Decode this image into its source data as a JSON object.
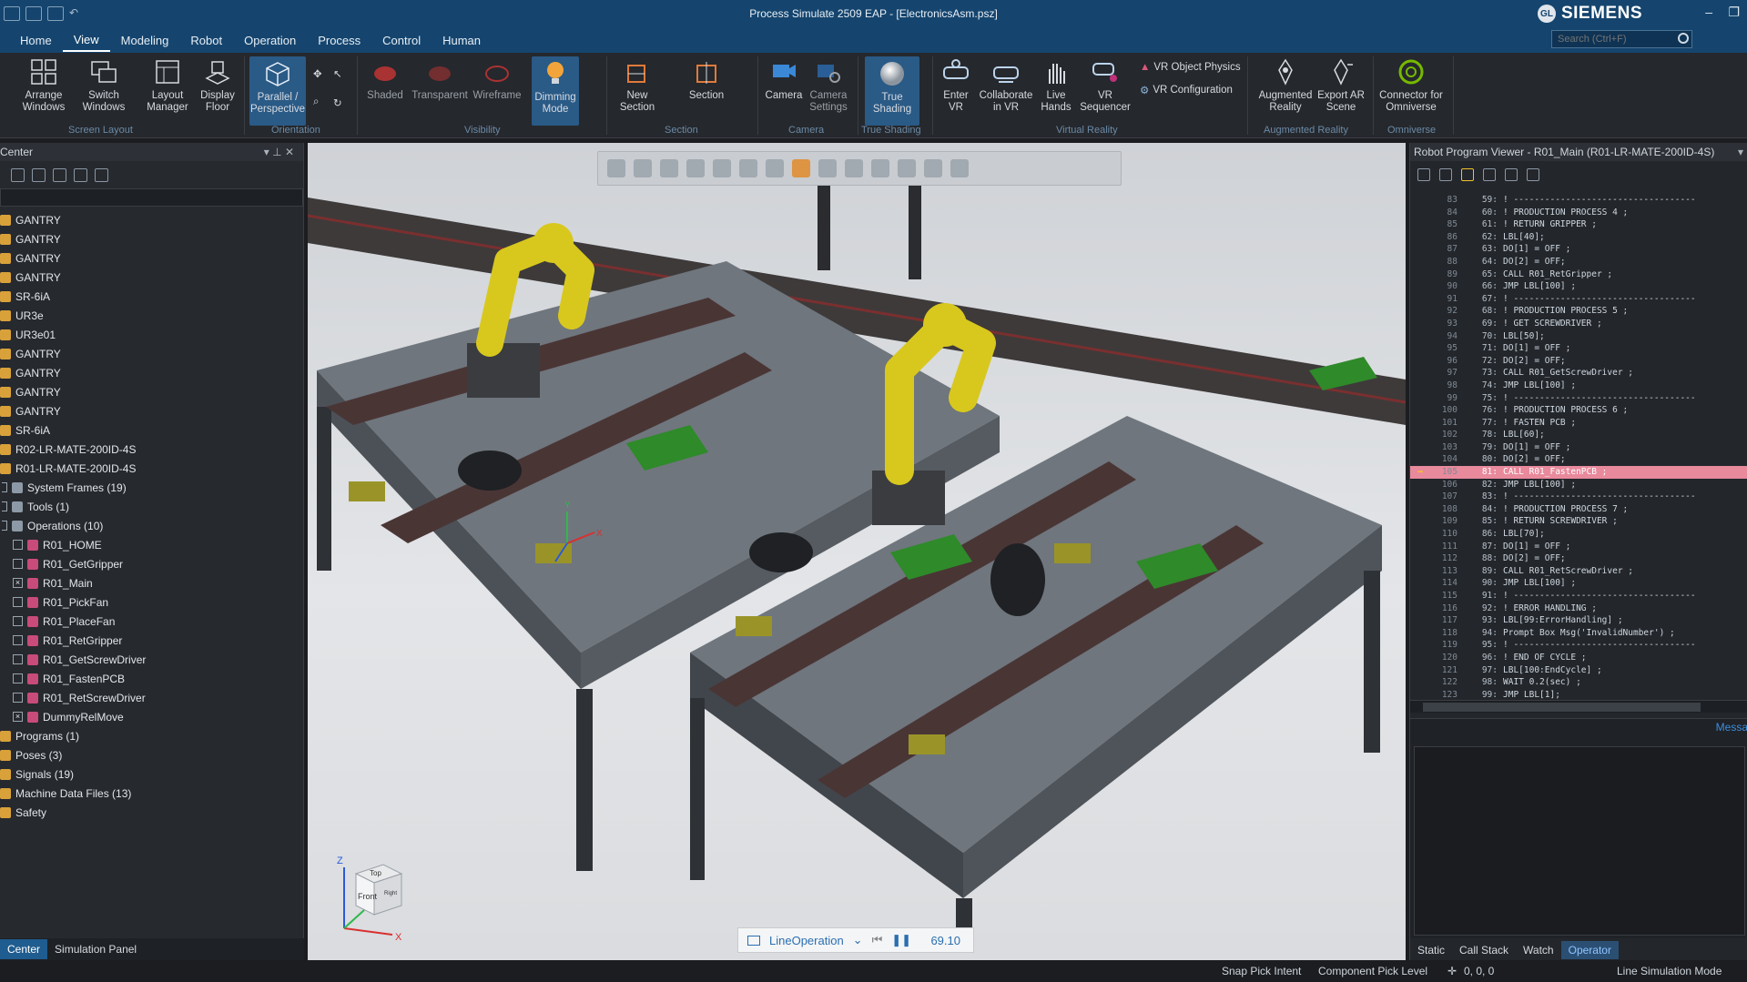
{
  "window": {
    "title": "Process Simulate 2509 EAP - [ElectronicsAsm.psz]",
    "brand": "SIEMENS",
    "user_initials": "GL"
  },
  "menu": {
    "tabs": [
      "Home",
      "View",
      "Modeling",
      "Robot",
      "Operation",
      "Process",
      "Control",
      "Human"
    ],
    "active": "View"
  },
  "search": {
    "placeholder": "Search (Ctrl+F)"
  },
  "ribbon": {
    "buttons": [
      {
        "label": "Arrange Windows",
        "icon": "arrange-windows-icon"
      },
      {
        "label": "Switch Windows",
        "icon": "switch-windows-icon"
      },
      {
        "label": "Layout Manager",
        "icon": "layout-manager-icon"
      },
      {
        "label": "Display Floor",
        "icon": "display-floor-icon"
      },
      {
        "label": "Parallel / Perspective",
        "icon": "perspective-cube-icon"
      },
      {
        "label": "Shaded",
        "icon": "shaded-icon"
      },
      {
        "label": "Transparent",
        "icon": "transparent-icon"
      },
      {
        "label": "Wireframe",
        "icon": "wireframe-icon"
      },
      {
        "label": "Dimming Mode",
        "icon": "lightbulb-icon"
      },
      {
        "label": "New Section",
        "icon": "new-section-icon"
      },
      {
        "label": "Section",
        "icon": "section-icon"
      },
      {
        "label": "Camera",
        "icon": "camera-icon"
      },
      {
        "label": "Camera Settings",
        "icon": "camera-settings-icon"
      },
      {
        "label": "True Shading",
        "icon": "sphere-icon"
      },
      {
        "label": "Enter VR",
        "icon": "vr-icon"
      },
      {
        "label": "Collaborate in VR",
        "icon": "vr-collaborate-icon"
      },
      {
        "label": "Live Hands",
        "icon": "live-hands-icon"
      },
      {
        "label": "VR Sequencer",
        "icon": "vr-sequencer-icon"
      },
      {
        "label": "Augmented Reality",
        "icon": "augmented-reality-icon"
      },
      {
        "label": "Export AR Scene",
        "icon": "export-ar-icon"
      },
      {
        "label": "Connector for Omniverse",
        "icon": "omniverse-icon"
      }
    ],
    "small": {
      "vr_object_physics": "VR Object Physics",
      "vr_configuration": "VR Configuration"
    },
    "groups": [
      "Screen Layout",
      "Orientation",
      "Visibility",
      "Section",
      "Camera",
      "True Shading",
      "Virtual Reality",
      "Augmented Reality",
      "Omniverse"
    ]
  },
  "left_panel": {
    "title": "Center",
    "rows": [
      {
        "label": "GANTRY",
        "level": 0
      },
      {
        "label": "GANTRY",
        "level": 0
      },
      {
        "label": "GANTRY",
        "level": 0
      },
      {
        "label": "GANTRY",
        "level": 0
      },
      {
        "label": "SR-6iA",
        "level": 0
      },
      {
        "label": "UR3e",
        "level": 0
      },
      {
        "label": "UR3e01",
        "level": 0
      },
      {
        "label": "GANTRY",
        "level": 0
      },
      {
        "label": "GANTRY",
        "level": 0
      },
      {
        "label": "GANTRY",
        "level": 0
      },
      {
        "label": "GANTRY",
        "level": 0
      },
      {
        "label": "SR-6iA",
        "level": 0
      },
      {
        "label": "R02-LR-MATE-200ID-4S",
        "level": 0
      },
      {
        "label": "R01-LR-MATE-200ID-4S",
        "level": 0
      },
      {
        "label": "System Frames (19)",
        "level": 1
      },
      {
        "label": "Tools (1)",
        "level": 1
      },
      {
        "label": "Operations (10)",
        "level": 1
      },
      {
        "label": "R01_HOME",
        "level": 2
      },
      {
        "label": "R01_GetGripper",
        "level": 2
      },
      {
        "label": "R01_Main",
        "level": 2,
        "checked": true
      },
      {
        "label": "R01_PickFan",
        "level": 2
      },
      {
        "label": "R01_PlaceFan",
        "level": 2
      },
      {
        "label": "R01_RetGripper",
        "level": 2
      },
      {
        "label": "R01_GetScrewDriver",
        "level": 2
      },
      {
        "label": "R01_FastenPCB",
        "level": 2
      },
      {
        "label": "R01_RetScrewDriver",
        "level": 2
      },
      {
        "label": "DummyRelMove",
        "level": 2,
        "checked": true
      },
      {
        "label": "Programs (1)",
        "level": 0
      },
      {
        "label": "Poses (3)",
        "level": 0
      },
      {
        "label": "Signals (19)",
        "level": 0
      },
      {
        "label": "Machine Data Files (13)",
        "level": 0
      },
      {
        "label": "Safety",
        "level": 0
      }
    ],
    "bottom_tabs": [
      "Center",
      "Simulation Panel"
    ]
  },
  "viewport": {
    "operation": "LineOperation",
    "time": "69.10",
    "orientation_cube": {
      "top": "Top",
      "front": "Front",
      "side": "Right"
    },
    "axes": {
      "x": "X",
      "y": "Y",
      "z": "Z"
    }
  },
  "right_panel": {
    "title": "Robot Program Viewer - R01_Main (R01-LR-MATE-200ID-4S)",
    "current_line": 105,
    "code": [
      {
        "ln": 83,
        "sn": "59:",
        "tx": "! -----------------------------------"
      },
      {
        "ln": 84,
        "sn": "60:",
        "tx": "! PRODUCTION PROCESS 4 ;"
      },
      {
        "ln": 85,
        "sn": "61:",
        "tx": "! RETURN GRIPPER ;"
      },
      {
        "ln": 86,
        "sn": "62:",
        "tx": "LBL[40];"
      },
      {
        "ln": 87,
        "sn": "63:",
        "tx": "DO[1] = OFF ;"
      },
      {
        "ln": 88,
        "sn": "64:",
        "tx": "DO[2] = OFF;"
      },
      {
        "ln": 89,
        "sn": "65:",
        "tx": "CALL R01_RetGripper ;"
      },
      {
        "ln": 90,
        "sn": "66:",
        "tx": "JMP LBL[100] ;"
      },
      {
        "ln": 91,
        "sn": "67:",
        "tx": "! -----------------------------------"
      },
      {
        "ln": 92,
        "sn": "68:",
        "tx": "! PRODUCTION PROCESS 5 ;"
      },
      {
        "ln": 93,
        "sn": "69:",
        "tx": "! GET SCREWDRIVER ;"
      },
      {
        "ln": 94,
        "sn": "70:",
        "tx": "LBL[50];"
      },
      {
        "ln": 95,
        "sn": "71:",
        "tx": "DO[1] = OFF ;"
      },
      {
        "ln": 96,
        "sn": "72:",
        "tx": "DO[2] = OFF;"
      },
      {
        "ln": 97,
        "sn": "73:",
        "tx": "CALL R01_GetScrewDriver ;"
      },
      {
        "ln": 98,
        "sn": "74:",
        "tx": "JMP LBL[100] ;"
      },
      {
        "ln": 99,
        "sn": "75:",
        "tx": "! -----------------------------------"
      },
      {
        "ln": 100,
        "sn": "76:",
        "tx": "! PRODUCTION PROCESS 6 ;"
      },
      {
        "ln": 101,
        "sn": "77:",
        "tx": "! FASTEN PCB ;"
      },
      {
        "ln": 102,
        "sn": "78:",
        "tx": "LBL[60];"
      },
      {
        "ln": 103,
        "sn": "79:",
        "tx": "DO[1] = OFF ;"
      },
      {
        "ln": 104,
        "sn": "80:",
        "tx": "DO[2] = OFF;"
      },
      {
        "ln": 105,
        "sn": "81:",
        "tx": "CALL R01_FastenPCB ;"
      },
      {
        "ln": 106,
        "sn": "82:",
        "tx": "JMP LBL[100] ;"
      },
      {
        "ln": 107,
        "sn": "83:",
        "tx": "! -----------------------------------"
      },
      {
        "ln": 108,
        "sn": "84:",
        "tx": "! PRODUCTION PROCESS 7 ;"
      },
      {
        "ln": 109,
        "sn": "85:",
        "tx": "! RETURN SCREWDRIVER ;"
      },
      {
        "ln": 110,
        "sn": "86:",
        "tx": "LBL[70];"
      },
      {
        "ln": 111,
        "sn": "87:",
        "tx": "DO[1] = OFF ;"
      },
      {
        "ln": 112,
        "sn": "88:",
        "tx": "DO[2] = OFF;"
      },
      {
        "ln": 113,
        "sn": "89:",
        "tx": "CALL R01_RetScrewDriver ;"
      },
      {
        "ln": 114,
        "sn": "90:",
        "tx": "JMP LBL[100] ;"
      },
      {
        "ln": 115,
        "sn": "91:",
        "tx": "! -----------------------------------"
      },
      {
        "ln": 116,
        "sn": "92:",
        "tx": "! ERROR HANDLING ;"
      },
      {
        "ln": 117,
        "sn": "93:",
        "tx": "LBL[99:ErrorHandling] ;"
      },
      {
        "ln": 118,
        "sn": "94:",
        "tx": "Prompt Box Msg('InvalidNumber') ;"
      },
      {
        "ln": 119,
        "sn": "95:",
        "tx": "! -----------------------------------"
      },
      {
        "ln": 120,
        "sn": "96:",
        "tx": "! END OF CYCLE ;"
      },
      {
        "ln": 121,
        "sn": "97:",
        "tx": "LBL[100:EndCycle] ;"
      },
      {
        "ln": 122,
        "sn": "98:",
        "tx": "WAIT 0.2(sec) ;"
      },
      {
        "ln": 123,
        "sn": "99:",
        "tx": "JMP LBL[1];"
      }
    ],
    "messages_title": "Messa",
    "tabs": [
      "Static",
      "Call Stack",
      "Watch",
      "Operator"
    ],
    "active_tab": "Operator"
  },
  "statusbar": {
    "snap": "Snap Pick Intent",
    "component": "Component Pick Level",
    "coords": "0, 0, 0",
    "mode": "Line Simulation Mode"
  },
  "colors": {
    "accent": "#1f5c8f",
    "title_bg": "#15456e",
    "robot_yellow": "#d8c81e",
    "current_line": "#e8899c"
  }
}
